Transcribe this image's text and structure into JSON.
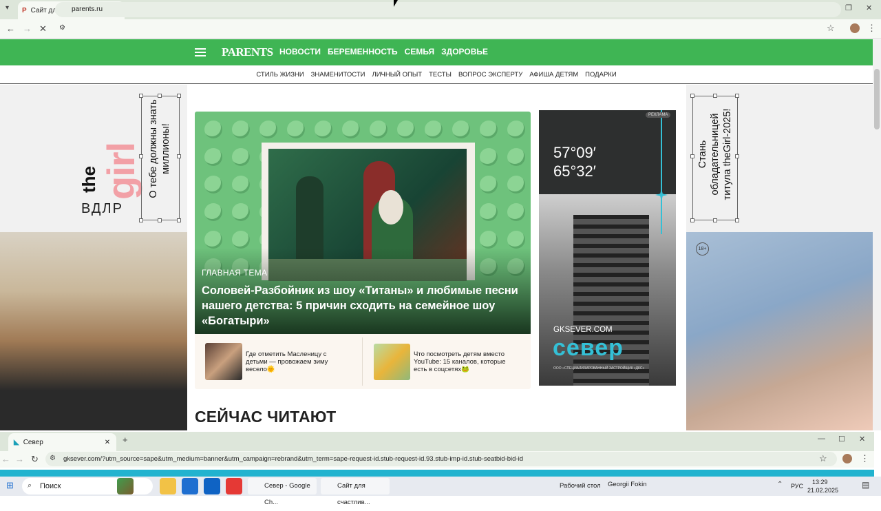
{
  "browser1": {
    "tab_title": "Сайт для счастливых родителе",
    "url": "parents.ru"
  },
  "site": {
    "logo": "PARENTS",
    "main_nav": [
      "НОВОСТИ",
      "БЕРЕМЕННОСТЬ",
      "СЕМЬЯ",
      "ЗДОРОВЬЕ"
    ],
    "sub_nav": [
      "СТИЛЬ ЖИЗНИ",
      "ЗНАМЕНИТОСТИ",
      "ЛИЧНЫЙ ОПЫТ",
      "ТЕСТЫ",
      "ВОПРОС ЭКСПЕРТУ",
      "АФИША ДЕТЯМ",
      "ПОДАРКИ"
    ],
    "hero": {
      "tag": "ГЛАВНАЯ ТЕМА",
      "title": "Соловей-Разбойник из шоу «Титаны» и любимые песни нашего детства: 5 причин сходить на семейное шоу «Богатыри»"
    },
    "cards": [
      {
        "text": "Где отметить Масленицу с детьми — провожаем зиму весело🌞"
      },
      {
        "text": "Что посмотреть детям вместо YouTube: 15 каналов, которые есть в соцсетях🐸"
      }
    ],
    "section_title": "СЕЙЧАС ЧИТАЮТ",
    "ad": {
      "label": "РЕКЛАМА",
      "coord1": "57°09′",
      "coord2": "65°32′",
      "site": "GKSEVER.COM",
      "brand": "север",
      "fine_print": "ООО «СПЕЦИАЛИЗИРОВАННЫЙ ЗАСТРОЙЩИК «ДКС»"
    },
    "left_banner": {
      "the": "the",
      "girl": "girl",
      "vdr": "ВДЛР",
      "text": "О тебе должны знать миллионы!"
    },
    "right_banner": {
      "text": "Стань обладательницей титула theGirl-2025!",
      "age": "18+"
    }
  },
  "browser2": {
    "tab_title": "Север",
    "url": "gksever.com/?utm_source=sape&utm_medium=banner&utm_campaign=rebrand&utm_term=sape-request-id.stub-request-id.93.stub-imp-id.stub-seatbid-bid-id"
  },
  "taskbar": {
    "search": "Поиск",
    "win1": "Север - Google Ch...",
    "win2": "Сайт для счастлив...",
    "desktop": "Рабочий стол",
    "user": "Georgii Fokin",
    "lang": "РУС",
    "time": "13:29",
    "date": "21.02.2025"
  }
}
